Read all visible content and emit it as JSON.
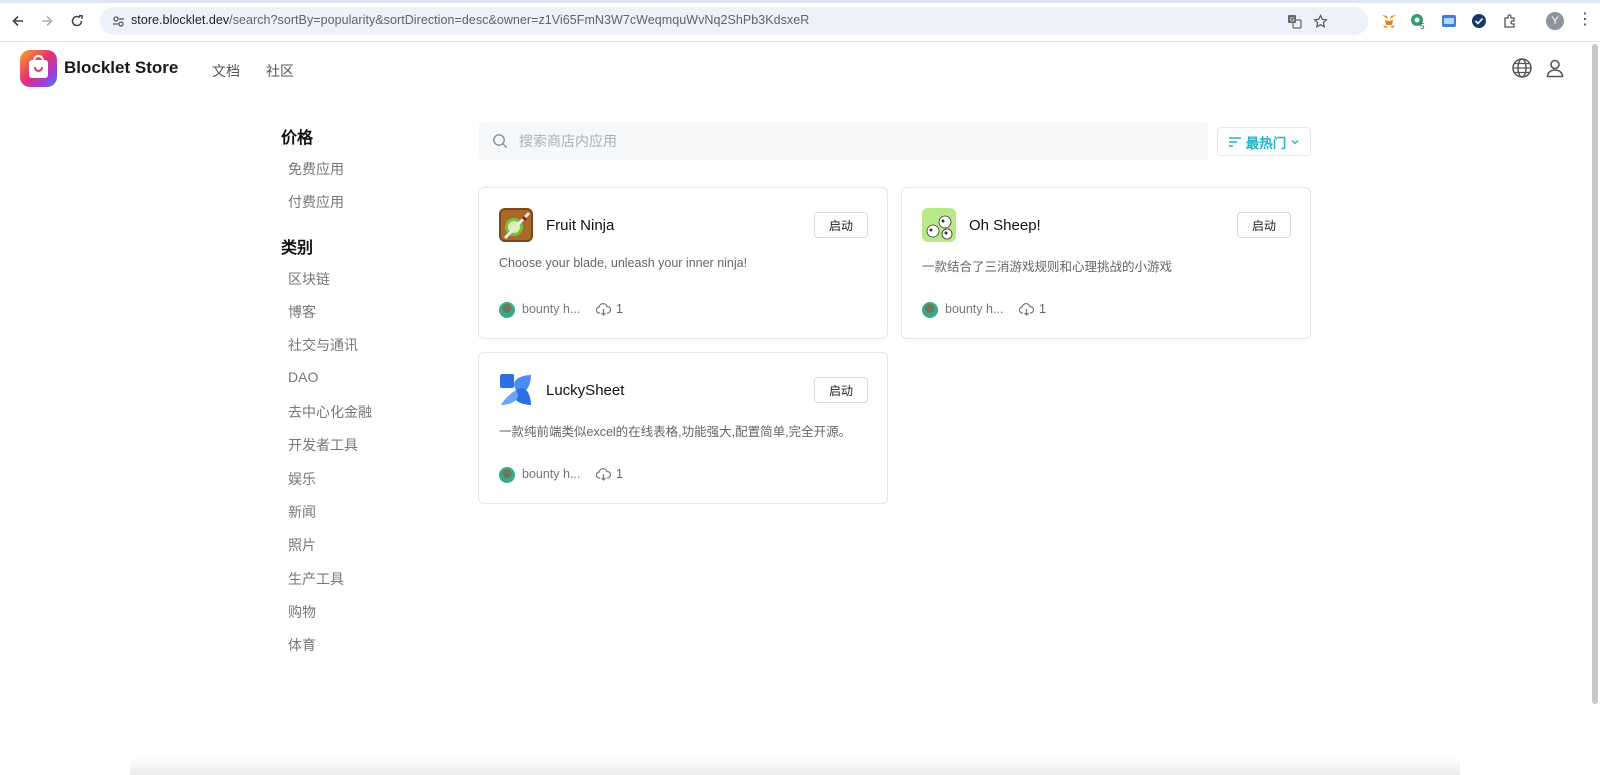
{
  "browser": {
    "url_host": "store.blocklet.dev",
    "url_path": "/search?sortBy=popularity&sortDirection=desc&owner=z1Vi65FmN3W7cWeqmquWvNq2ShPb3KdsxeR",
    "profile_initial": "Y",
    "extension_badge": "5"
  },
  "header": {
    "brand": "Blocklet Store",
    "nav": [
      "文档",
      "社区"
    ]
  },
  "sidebar": {
    "price_heading": "价格",
    "price_items": [
      "免费应用",
      "付费应用"
    ],
    "category_heading": "类别",
    "category_items": [
      "区块链",
      "博客",
      "社交与通讯",
      "DAO",
      "去中心化金融",
      "开发者工具",
      "娱乐",
      "新闻",
      "照片",
      "生产工具",
      "购物",
      "体育"
    ]
  },
  "search": {
    "placeholder": "搜索商店内应用",
    "value": ""
  },
  "sort": {
    "label": "最热门"
  },
  "cards": [
    {
      "title": "Fruit Ninja",
      "button": "启动",
      "description": "Choose your blade, unleash your inner ninja!",
      "author": "bounty h...",
      "downloads": "1",
      "icon": "fruit-ninja-icon"
    },
    {
      "title": "Oh Sheep!",
      "button": "启动",
      "description": "一款结合了三消游戏规则和心理挑战的小游戏",
      "author": "bounty h...",
      "downloads": "1",
      "icon": "sheep-icon"
    },
    {
      "title": "LuckySheet",
      "button": "启动",
      "description": "一款纯前端类似excel的在线表格,功能强大,配置简单,完全开源。",
      "author": "bounty h...",
      "downloads": "1",
      "icon": "luckysheet-icon"
    }
  ],
  "colors": {
    "accent": "#23b5c4",
    "card_border": "#e2e5e9"
  }
}
